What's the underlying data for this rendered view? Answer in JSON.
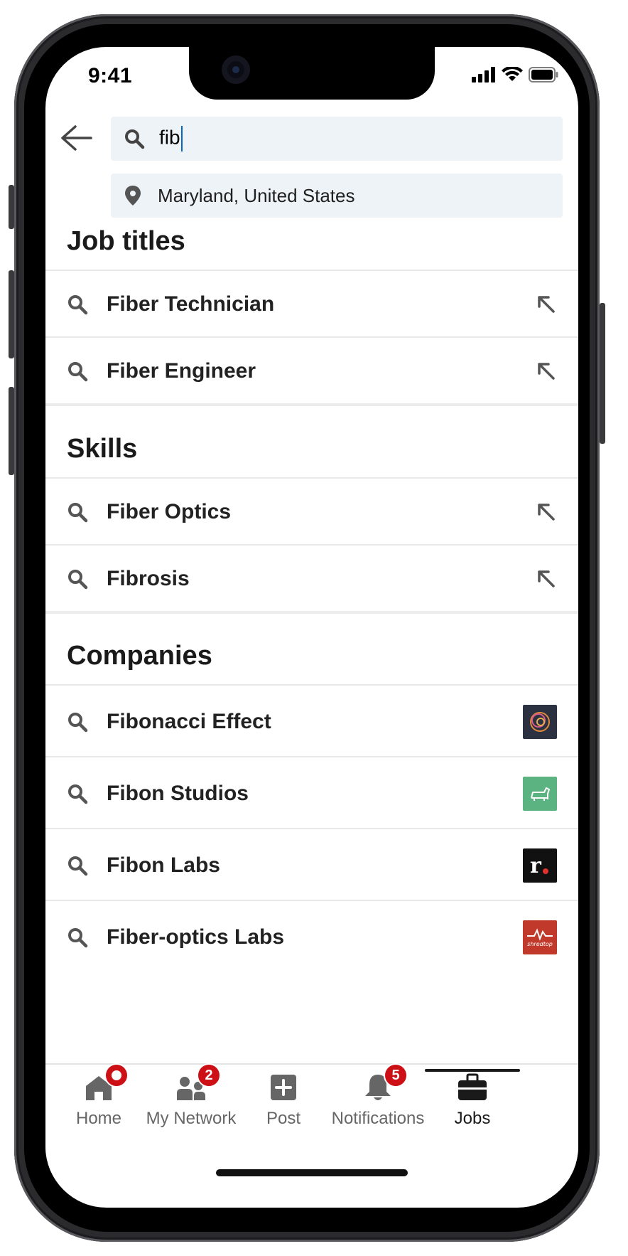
{
  "status_bar": {
    "time": "9:41"
  },
  "search": {
    "query": "fib",
    "location": "Maryland, United States"
  },
  "sections": {
    "job_titles": {
      "title": "Job titles",
      "items": [
        {
          "label": "Fiber Technician"
        },
        {
          "label": "Fiber Engineer"
        }
      ]
    },
    "skills": {
      "title": "Skills",
      "items": [
        {
          "label": "Fiber Optics"
        },
        {
          "label": "Fibrosis"
        }
      ]
    },
    "companies": {
      "title": "Companies",
      "items": [
        {
          "label": "Fibonacci Effect",
          "logo": "fibonacci-effect-logo",
          "logo_bg": "#2b3140"
        },
        {
          "label": "Fibon Studios",
          "logo": "fibon-studios-logo",
          "logo_bg": "#5bb381"
        },
        {
          "label": "Fibon Labs",
          "logo": "fibon-labs-logo",
          "logo_text": "r.",
          "logo_bg": "#111111"
        },
        {
          "label": "Fiber-optics Labs",
          "logo": "fiber-optics-labs-logo",
          "logo_text": "shredtop",
          "logo_bg": "#c0392b"
        }
      ]
    }
  },
  "tabbar": {
    "tabs": [
      {
        "label": "Home",
        "icon": "home-icon",
        "badge_dot": true
      },
      {
        "label": "My Network",
        "icon": "network-icon",
        "badge": "2"
      },
      {
        "label": "Post",
        "icon": "post-icon"
      },
      {
        "label": "Notifications",
        "icon": "bell-icon",
        "badge": "5"
      },
      {
        "label": "Jobs",
        "icon": "briefcase-icon",
        "active": true
      }
    ]
  },
  "colors": {
    "accent": "#0a66c2",
    "badge": "#cc1016",
    "field_bg": "#eef3f8"
  }
}
